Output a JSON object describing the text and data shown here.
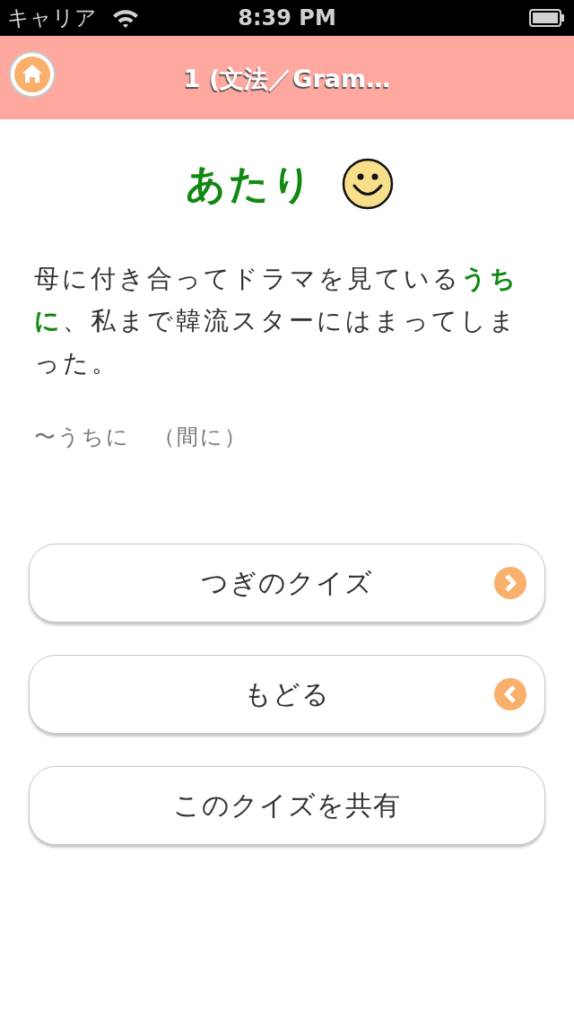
{
  "status_bar": {
    "carrier": "キャリア",
    "time": "8:39 PM"
  },
  "nav_bar": {
    "title": "1 (文法／Gram…"
  },
  "result": {
    "label": "あたり",
    "kind": "correct"
  },
  "sentence": "母に付き合ってドラマを見ている**うちに**、私まで韓流スターにはまってしまった。",
  "note": "〜うちに　（間に）",
  "buttons": [
    {
      "label": "つぎのクイズ",
      "kind": "next"
    },
    {
      "label": "もどる",
      "kind": "back"
    },
    {
      "label": "このクイズを共有",
      "kind": "share"
    }
  ]
}
